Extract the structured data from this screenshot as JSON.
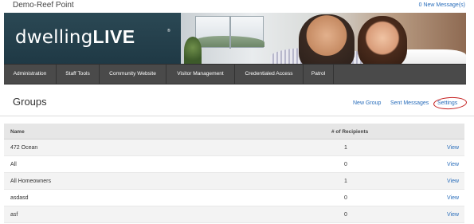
{
  "site": {
    "title": "Demo-Reef Point",
    "messages_link": "0 New Message(s)"
  },
  "banner": {
    "logo_thin": "dwelling",
    "logo_bold": "LIVE",
    "logo_mark": "®"
  },
  "nav": {
    "items": [
      {
        "label": "Administration"
      },
      {
        "label": "Staff Tools"
      },
      {
        "label": "Community Website"
      },
      {
        "label": "Visitor Management"
      },
      {
        "label": "Credentialed Access"
      },
      {
        "label": "Patrol"
      }
    ]
  },
  "page": {
    "title": "Groups",
    "actions": {
      "new_group": "New Group",
      "sent_messages": "Sent Messages",
      "settings": "Settings"
    }
  },
  "table": {
    "headers": {
      "name": "Name",
      "recipients": "# of Recipients"
    },
    "rows": [
      {
        "name": "472 Ocean",
        "recipients": "1",
        "action": "View"
      },
      {
        "name": "All",
        "recipients": "0",
        "action": "View"
      },
      {
        "name": "All Homeowners",
        "recipients": "1",
        "action": "View"
      },
      {
        "name": "asdasd",
        "recipients": "0",
        "action": "View"
      },
      {
        "name": "asf",
        "recipients": "0",
        "action": "View"
      }
    ]
  },
  "colors": {
    "link": "#2a6ebb",
    "nav_bg": "#4a4a4a",
    "annotation_circle": "#c41a1a"
  }
}
